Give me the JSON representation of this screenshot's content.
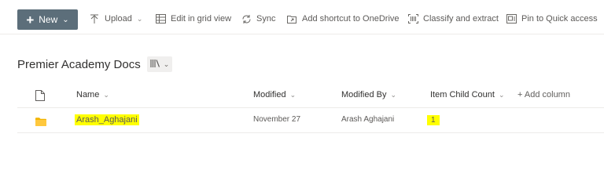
{
  "toolbar": {
    "new_label": "New",
    "upload_label": "Upload",
    "edit_grid_label": "Edit in grid view",
    "sync_label": "Sync",
    "add_shortcut_label": "Add shortcut to OneDrive",
    "classify_label": "Classify and extract",
    "pin_label": "Pin to Quick access"
  },
  "library": {
    "title": "Premier Academy Docs"
  },
  "columns": {
    "name": "Name",
    "modified": "Modified",
    "modified_by": "Modified By",
    "item_child_count": "Item Child Count",
    "add_column": "+ Add column"
  },
  "rows": [
    {
      "name": "Arash_Aghajani",
      "modified": "November 27",
      "modified_by": "Arash Aghajani",
      "item_child_count": "1"
    }
  ],
  "colors": {
    "new_button": "#5c6e7a",
    "folder": "#f2b400",
    "highlight": "#ffff00"
  },
  "icons": {
    "upload": "upload-icon",
    "grid": "grid-icon",
    "sync": "sync-icon",
    "shortcut": "shortcut-icon",
    "classify": "classify-icon",
    "pin": "pin-icon",
    "library_view": "library-view-icon",
    "file_type": "file-type-icon",
    "folder": "folder-icon"
  }
}
